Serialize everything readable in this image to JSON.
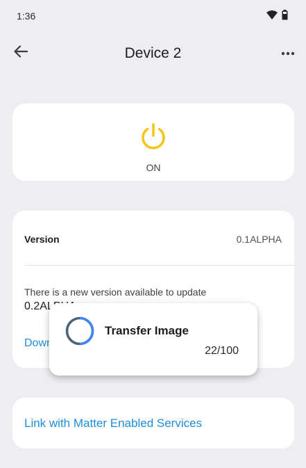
{
  "status_bar": {
    "time": "1:36",
    "icons": [
      "wifi-icon",
      "battery-icon"
    ]
  },
  "app_bar": {
    "title": "Device 2",
    "back_icon": "arrow-back-icon",
    "more_icon": "more-horizontal-icon"
  },
  "power": {
    "icon": "power-icon",
    "state_label": "ON",
    "icon_color": "#f5c518"
  },
  "version": {
    "label": "Version",
    "value": "0.1ALPHA",
    "update_message": "There is a new version available to update",
    "new_version": "0.2ALPHA",
    "download_label": "Download"
  },
  "matter_link": {
    "label": "Link with Matter Enabled Services"
  },
  "dialog": {
    "title": "Transfer Image",
    "progress": "22/100",
    "progress_value": 0.22,
    "spinner_colors": [
      "#4285f4",
      "#4b6478"
    ]
  },
  "colors": {
    "background": "#eeedf2",
    "card": "#ffffff",
    "link": "#1d8ddb"
  }
}
